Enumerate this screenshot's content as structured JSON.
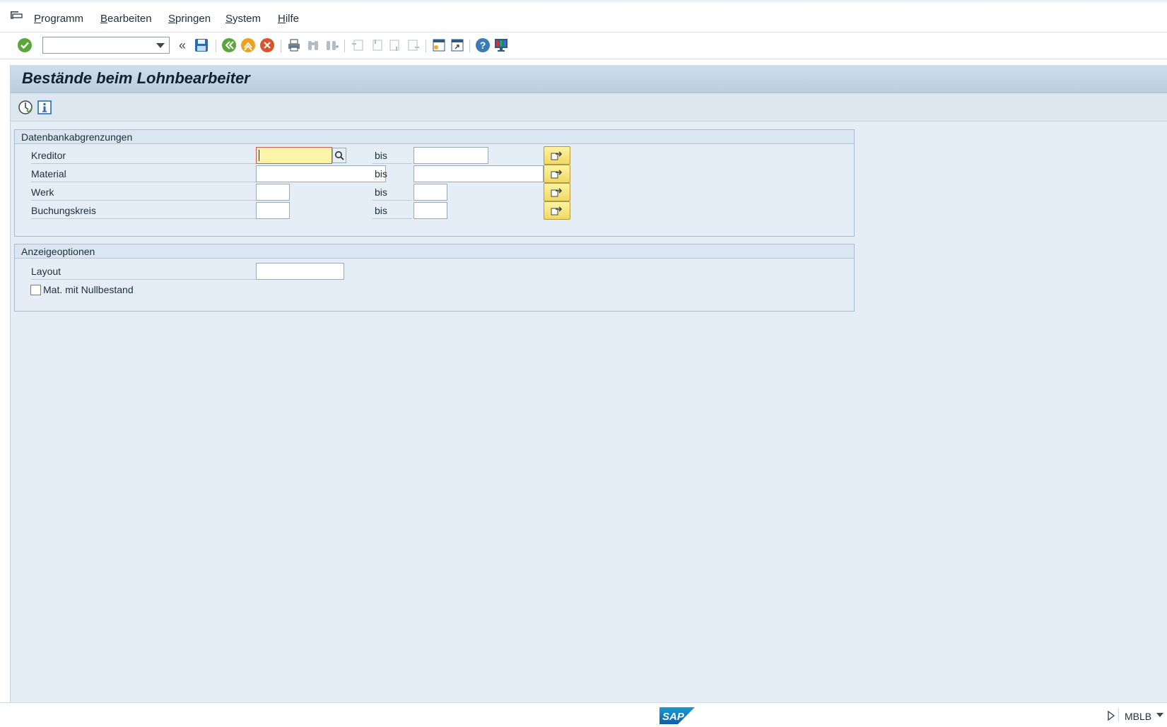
{
  "menu": {
    "items": [
      {
        "mnemonic": "P",
        "rest": "rogramm"
      },
      {
        "mnemonic": "B",
        "rest": "earbeiten"
      },
      {
        "mnemonic": "S",
        "rest": "pringen"
      },
      {
        "mnemonic": "S",
        "rest": "ystem"
      },
      {
        "mnemonic": "H",
        "rest": "ilfe"
      }
    ]
  },
  "toolbar": {
    "command_field_value": "",
    "collapse_glyph": "«"
  },
  "screen": {
    "title": "Bestände beim Lohnbearbeiter"
  },
  "groups": {
    "db": {
      "header": "Datenbankabgrenzungen",
      "rows": [
        {
          "label": "Kreditor",
          "low": "",
          "bis": "bis",
          "high": ""
        },
        {
          "label": "Material",
          "low": "",
          "bis": "bis",
          "high": ""
        },
        {
          "label": "Werk",
          "low": "",
          "bis": "bis",
          "high": ""
        },
        {
          "label": "Buchungskreis",
          "low": "",
          "bis": "bis",
          "high": ""
        }
      ]
    },
    "display": {
      "header": "Anzeigeoptionen",
      "layout_label": "Layout",
      "layout_value": "",
      "checkbox_label": "Mat. mit Nullbestand",
      "checkbox_checked": false
    }
  },
  "statusbar": {
    "logo_text": "SAP",
    "transaction": "MBLB"
  },
  "colors": {
    "accent": "#3c6e9c",
    "focused_field": "#fef4a7",
    "area_background": "#e5eef6"
  }
}
